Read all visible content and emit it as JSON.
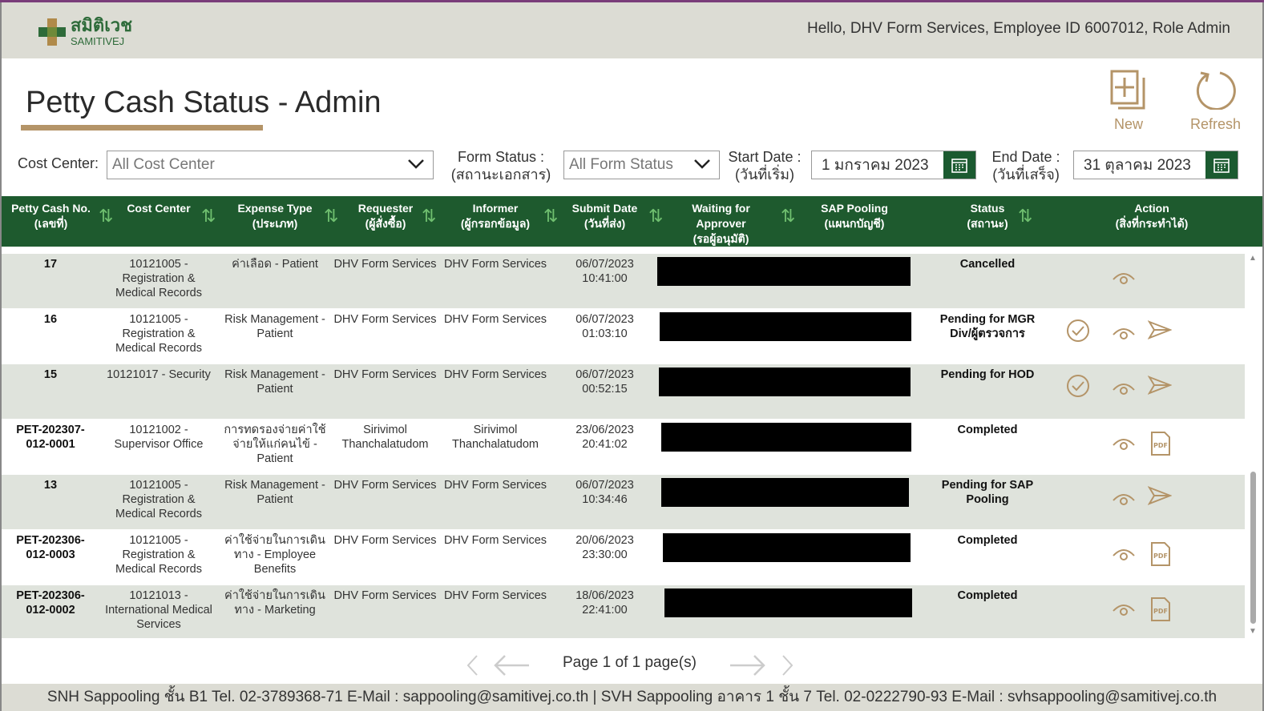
{
  "header": {
    "logo_th": "สมิติเวช",
    "logo_en": "SAMITIVEJ",
    "greeting": "Hello, DHV Form Services, Employee ID 6007012, Role Admin"
  },
  "page": {
    "title": "Petty Cash Status - Admin"
  },
  "toolbar": {
    "new_label": "New",
    "refresh_label": "Refresh"
  },
  "filters": {
    "cost_center_label": "Cost Center:",
    "cost_center_value": "All Cost Center",
    "form_status_label": "Form Status :",
    "form_status_label_th": "(สถานะเอกสาร)",
    "form_status_value": "All Form Status",
    "start_date_label": "Start Date :",
    "start_date_label_th": "(วันที่เริ่ม)",
    "start_date_value": "1 มกราคม 2023",
    "end_date_label": "End Date :",
    "end_date_label_th": "(วันที่เสร็จ)",
    "end_date_value": "31 ตุลาคม 2023"
  },
  "table": {
    "columns": [
      {
        "label": "Petty Cash No.",
        "sub": "(เลขที่)"
      },
      {
        "label": "Cost Center",
        "sub": ""
      },
      {
        "label": "Expense Type",
        "sub": "(ประเภท)"
      },
      {
        "label": "Requester",
        "sub": "(ผู้สั่งซื้อ)"
      },
      {
        "label": "Informer",
        "sub": "(ผู้กรอกข้อมูล)"
      },
      {
        "label": "Submit Date",
        "sub": "(วันที่ส่ง)"
      },
      {
        "label": "Waiting for",
        "sub": "Approver",
        "sub2": "(รอผู้อนุมัติ)"
      },
      {
        "label": "SAP Pooling",
        "sub": "(แผนกบัญชี)"
      },
      {
        "label": "Status",
        "sub": "(สถานะ)"
      },
      {
        "label": "Action",
        "sub": "(สิ่งที่กระทำได้)"
      }
    ],
    "rows": [
      {
        "no": [
          "17"
        ],
        "cost": [
          "10121005 -",
          "Registration &",
          "Medical Records"
        ],
        "expense": [
          "ค่าเลือด - Patient"
        ],
        "requester": [
          "DHV Form Services"
        ],
        "informer": [
          "DHV Form Services"
        ],
        "date": [
          "06/07/2023",
          "10:41:00"
        ],
        "status": [
          "Cancelled"
        ],
        "actions": [
          "view-icon"
        ]
      },
      {
        "no": [
          "16"
        ],
        "cost": [
          "10121005 -",
          "Registration &",
          "Medical Records"
        ],
        "expense": [
          "Risk Management -",
          "Patient"
        ],
        "requester": [
          "DHV Form Services"
        ],
        "informer": [
          "DHV Form Services"
        ],
        "date": [
          "06/07/2023",
          "01:03:10"
        ],
        "status": [
          "Pending for MGR",
          "Div/ผู้ตรวจการ"
        ],
        "actions": [
          "approve-icon",
          "view-icon",
          "send-icon"
        ]
      },
      {
        "no": [
          "15"
        ],
        "cost": [
          "10121017 - Security"
        ],
        "expense": [
          "Risk Management -",
          "Patient"
        ],
        "requester": [
          "DHV Form Services"
        ],
        "informer": [
          "DHV Form Services"
        ],
        "date": [
          "06/07/2023",
          "00:52:15"
        ],
        "status": [
          "Pending for HOD"
        ],
        "actions": [
          "approve-icon",
          "view-icon",
          "send-icon"
        ]
      },
      {
        "no": [
          "PET-202307-",
          "012-0001"
        ],
        "cost": [
          "10121002 -",
          "Supervisor Office"
        ],
        "expense": [
          "การทดรองจ่ายค่าใช้",
          "จ่ายให้แก่คนไข้ -",
          "Patient"
        ],
        "requester": [
          "Sirivimol",
          "Thanchalatudom"
        ],
        "informer": [
          "Sirivimol",
          "Thanchalatudom"
        ],
        "date": [
          "23/06/2023",
          "20:41:02"
        ],
        "status": [
          "Completed"
        ],
        "actions": [
          "view-icon",
          "pdf-icon"
        ]
      },
      {
        "no": [
          "13"
        ],
        "cost": [
          "10121005 -",
          "Registration &",
          "Medical Records"
        ],
        "expense": [
          "Risk Management -",
          "Patient"
        ],
        "requester": [
          "DHV Form Services"
        ],
        "informer": [
          "DHV Form Services"
        ],
        "date": [
          "06/07/2023",
          "10:34:46"
        ],
        "status": [
          "Pending for SAP",
          "Pooling"
        ],
        "actions": [
          "view-icon",
          "send-icon"
        ]
      },
      {
        "no": [
          "PET-202306-",
          "012-0003"
        ],
        "cost": [
          "10121005 -",
          "Registration &",
          "Medical Records"
        ],
        "expense": [
          "ค่าใช้จ่ายในการเดิน",
          "ทาง - Employee",
          "Benefits"
        ],
        "requester": [
          "DHV Form Services"
        ],
        "informer": [
          "DHV Form Services"
        ],
        "date": [
          "20/06/2023",
          "23:30:00"
        ],
        "status": [
          "Completed"
        ],
        "actions": [
          "view-icon",
          "pdf-icon"
        ]
      },
      {
        "no": [
          "PET-202306-",
          "012-0002"
        ],
        "cost": [
          "10121013 -",
          "International Medical",
          "Services"
        ],
        "expense": [
          "ค่าใช้จ่ายในการเดิน",
          "ทาง - Marketing"
        ],
        "requester": [
          "DHV Form Services"
        ],
        "informer": [
          "DHV Form Services"
        ],
        "date": [
          "18/06/2023",
          "22:41:00"
        ],
        "status": [
          "Completed"
        ],
        "actions": [
          "view-icon",
          "pdf-icon"
        ]
      }
    ]
  },
  "pager": {
    "text": "Page 1 of 1 page(s)"
  },
  "footer": {
    "text": "SNH Sappooling ชั้น B1  Tel. 02-3789368-71  E-Mail : sappooling@samitivej.co.th | SVH Sappooling อาคาร 1 ชั้น 7  Tel. 02-0222790-93  E-Mail : svhsappooling@samitivej.co.th"
  },
  "colors": {
    "brand_green": "#1e5a2e",
    "accent_gold": "#b49468",
    "row_alt": "#dfe3dc"
  }
}
